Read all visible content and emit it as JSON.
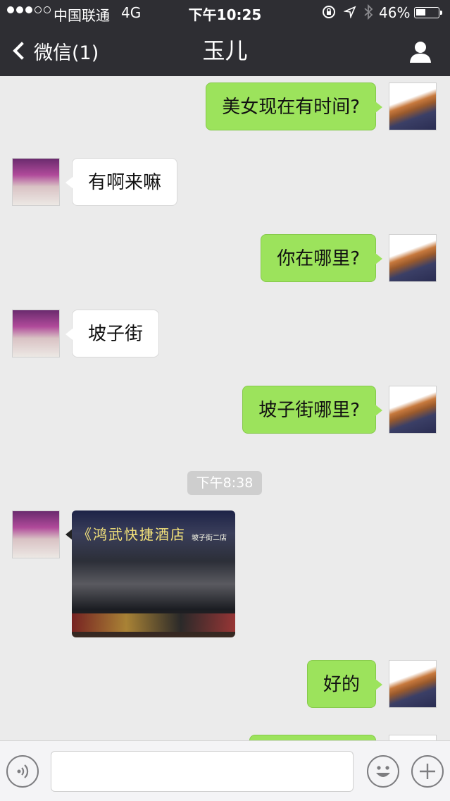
{
  "status_bar": {
    "carrier": "中国联通",
    "network": "4G",
    "time": "下午10:25",
    "battery": "46%",
    "battery_level": 0.46
  },
  "nav": {
    "back_label": "微信(1)",
    "title": "玉儿"
  },
  "messages": [
    {
      "side": "right",
      "text": "美女现在有时间?"
    },
    {
      "side": "left",
      "text": "有啊来嘛"
    },
    {
      "side": "right",
      "text": "你在哪里?"
    },
    {
      "side": "left",
      "text": "坡子街"
    },
    {
      "side": "right",
      "text": "坡子街哪里?"
    },
    {
      "type": "timestamp",
      "text": "下午8:38"
    },
    {
      "side": "left",
      "type": "image",
      "sign_text": "《鸿武快捷酒店",
      "sign_sub": "坡子街二店"
    },
    {
      "side": "right",
      "text": "好的"
    }
  ],
  "colors": {
    "nav_bg": "#2e2e33",
    "chat_bg": "#ebebeb",
    "outgoing_bubble": "#9ce35c",
    "incoming_bubble": "#ffffff"
  },
  "icons": {
    "back": "chevron-left-icon",
    "profile": "person-icon",
    "voice": "voice-icon",
    "emoji": "emoji-icon",
    "more": "plus-icon"
  }
}
